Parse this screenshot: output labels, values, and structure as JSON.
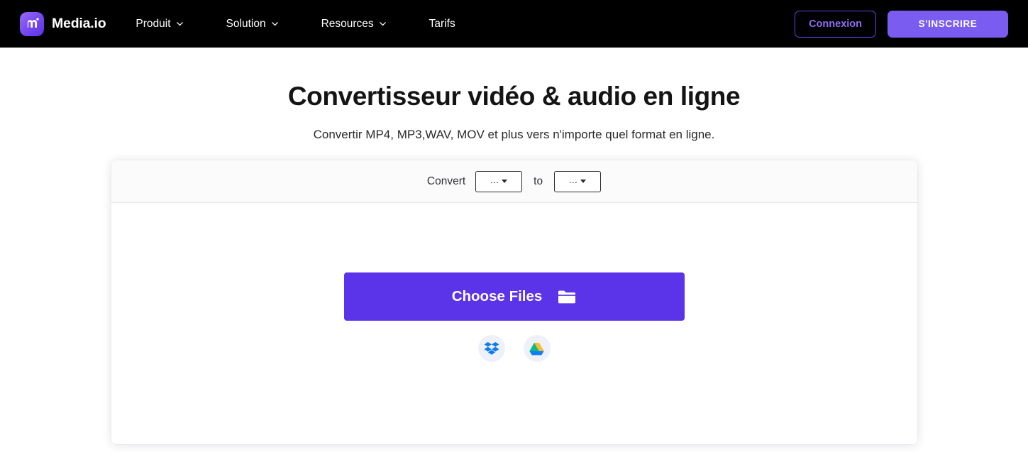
{
  "navbar": {
    "brand": {
      "name": "Media.io",
      "logo_icon": "media-io-logo-icon"
    },
    "links": [
      {
        "label": "Produit",
        "has_dropdown": true
      },
      {
        "label": "Solution",
        "has_dropdown": true
      },
      {
        "label": "Resources",
        "has_dropdown": true
      },
      {
        "label": "Tarifs",
        "has_dropdown": false
      }
    ],
    "login_label": "Connexion",
    "signup_label": "S'INSCRIRE",
    "background": "#000000",
    "accent": "#7b5cf0"
  },
  "hero": {
    "title": "Convertisseur vidéo & audio en ligne",
    "subtitle": "Convertir MP4, MP3,WAV, MOV et plus vers n'importe quel format en ligne."
  },
  "converter": {
    "convert_label": "Convert",
    "to_label": "to",
    "source_format": "...",
    "target_format": "...",
    "choose_files_label": "Choose Files",
    "folder_icon": "folder-icon",
    "cloud_sources": [
      {
        "name": "Dropbox",
        "icon": "dropbox-icon"
      },
      {
        "name": "Google Drive",
        "icon": "google-drive-icon"
      }
    ],
    "button_color": "#5b33e8"
  }
}
